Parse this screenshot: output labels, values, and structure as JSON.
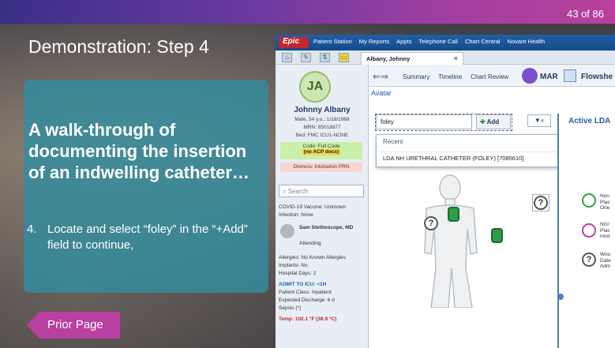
{
  "slide": {
    "counter": "43 of 86",
    "title": "Demonstration: Step 4",
    "headline": "A walk-through of documenting the insertion of an indwelling catheter…",
    "step_number": "4.",
    "step_text": "Locate and select “foley” in the “+Add” field to continue,",
    "prior_button": "Prior Page"
  },
  "ehr": {
    "epic_label": "Epic",
    "menu": [
      "Patient Station",
      "My Reports",
      "Appts",
      "Telephone Call",
      "Chart Central",
      "Novant Health"
    ],
    "patient_tab": "Albany, Johnny",
    "sidebar": {
      "initials": "JA",
      "name": "Johnny Albany",
      "line1": "Male, 54 y.o., 1/18/1968",
      "line2": "MRN: 85018877",
      "line3": "Bed: FMC ICU1-NONE",
      "code": "Code: Full Code",
      "acp": "(no ACP docs)",
      "distress": "Distress: Intubation PRN",
      "search_placeholder": "Search",
      "covid": "COVID-19 Vaccine: Unknown",
      "infection": "Infection: None",
      "provider_name": "Sam Stethoscope, MD",
      "provider_role": "Attending",
      "allergies": "Allergies: No Known Allergies",
      "implants": "Implants: No",
      "hospital_days": "Hospital Days: 2",
      "admit": "ADMIT TO ICU: <1H",
      "patient_class": "Patient Class: Inpatient",
      "discharge": "Expected Discharge: 6 d",
      "sepsis": "Sepsis (*)",
      "temp": "Temp: 102.1 °F (38.9 °C)"
    },
    "nav": {
      "tabs": [
        "Summary",
        "Timeline",
        "Chart Review"
      ],
      "mar": "MAR",
      "flowsheets": "Flowshe"
    },
    "breadcrumb": "Avatar",
    "search_value": "foley",
    "add_label": "Add",
    "dropdown": {
      "recent_label": "Recent",
      "item": "LDA NH URETHRAL CATHETER (FOLEY) [7085610]"
    },
    "filter_label": "▼«",
    "active_label": "Active LDA",
    "lda_items": [
      {
        "l1": "Non",
        "l2": "Plac",
        "l3": "Orie"
      },
      {
        "l1": "NG/",
        "l2": "Plac",
        "l3": "nost"
      },
      {
        "l1": "Wou",
        "l2": "Date",
        "l3": "Adm"
      }
    ],
    "colors": {
      "brand_red": "#c0282d",
      "accent_purple": "#b93fa0",
      "lda_green": "#2e9e4a"
    }
  }
}
